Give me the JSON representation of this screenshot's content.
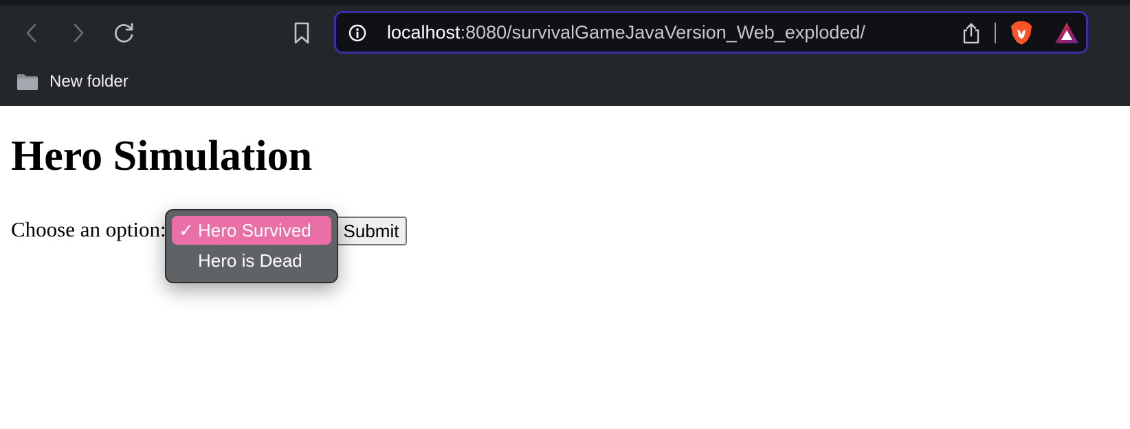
{
  "browser": {
    "url_host": "localhost",
    "url_path": ":8080/survivalGameJavaVersion_Web_exploded/",
    "bookmarks": [
      {
        "label": "New folder",
        "icon": "folder-icon"
      }
    ],
    "icons": {
      "back": "chevron-left-icon",
      "forward": "chevron-right-icon",
      "reload": "reload-icon",
      "bookmark": "bookmark-icon",
      "site_info": "info-icon",
      "share": "share-icon",
      "brave_shields": "brave-lion-icon",
      "rewards": "brave-rewards-icon"
    },
    "colors": {
      "chrome_bg": "#23262b",
      "address_border": "#3b2fa8",
      "address_bg": "#0f1115"
    }
  },
  "page": {
    "title": "Hero Simulation",
    "choose_label": "Choose an option:",
    "submit_label": "Submit",
    "select": {
      "selected_value": "Hero Survived",
      "options": [
        {
          "label": "Hero Survived",
          "selected": true
        },
        {
          "label": "Hero is Dead",
          "selected": false
        }
      ]
    },
    "colors": {
      "dropdown_bg": "#5f6366",
      "selected_bg": "#ea6fa6"
    }
  }
}
